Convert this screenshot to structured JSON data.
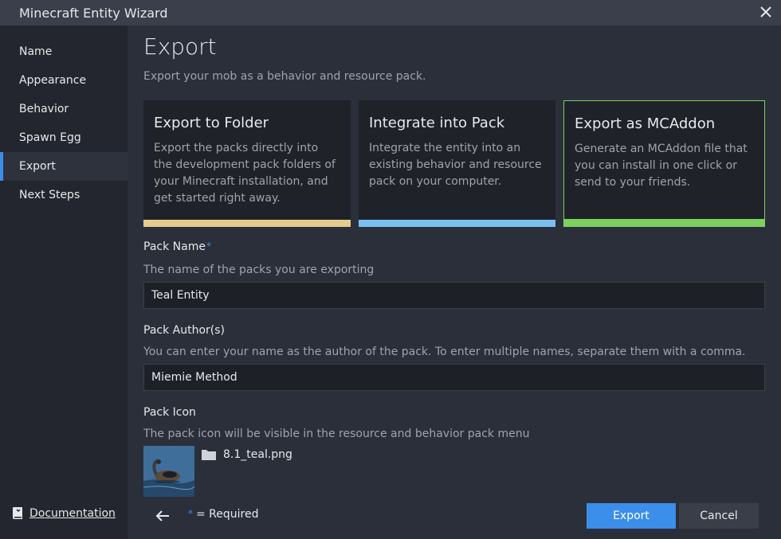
{
  "window": {
    "title": "Minecraft Entity Wizard"
  },
  "sidebar": {
    "items": [
      {
        "label": "Name"
      },
      {
        "label": "Appearance"
      },
      {
        "label": "Behavior"
      },
      {
        "label": "Spawn Egg"
      },
      {
        "label": "Export",
        "active": true
      },
      {
        "label": "Next Steps"
      }
    ],
    "documentation_label": "Documentation"
  },
  "page": {
    "title": "Export",
    "subtitle": "Export your mob as a behavior and resource pack."
  },
  "export_options": [
    {
      "title": "Export to Folder",
      "description": "Export the packs directly into the development pack folders of your Minecraft installation, and get started right away.",
      "accent": "#e3cc8e"
    },
    {
      "title": "Integrate into Pack",
      "description": "Integrate the entity into an existing behavior and resource pack on your computer.",
      "accent": "#79c0f0"
    },
    {
      "title": "Export as MCAddon",
      "description": "Generate an MCAddon file that you can install in one click or send to your friends.",
      "accent": "#7dd160",
      "selected": true
    }
  ],
  "fields": {
    "pack_name": {
      "label": "Pack Name",
      "description": "The name of the packs you are exporting",
      "value": "Teal Entity"
    },
    "pack_author": {
      "label": "Pack Author(s)",
      "description": "You can enter your name as the author of the pack. To enter multiple names, separate them with a comma.",
      "value": "Miemie Method"
    },
    "pack_icon": {
      "label": "Pack Icon",
      "description": "The pack icon will be visible in the resource and behavior pack menu",
      "file_name": "8.1_teal.png"
    }
  },
  "footer": {
    "required_star": "*",
    "required_text": "= Required",
    "export_label": "Export",
    "cancel_label": "Cancel"
  },
  "colors": {
    "accent": "#3b8eea",
    "sidebar_bg": "#23262e",
    "main_bg": "#2b2f3a",
    "card_bg": "#1f2229"
  }
}
